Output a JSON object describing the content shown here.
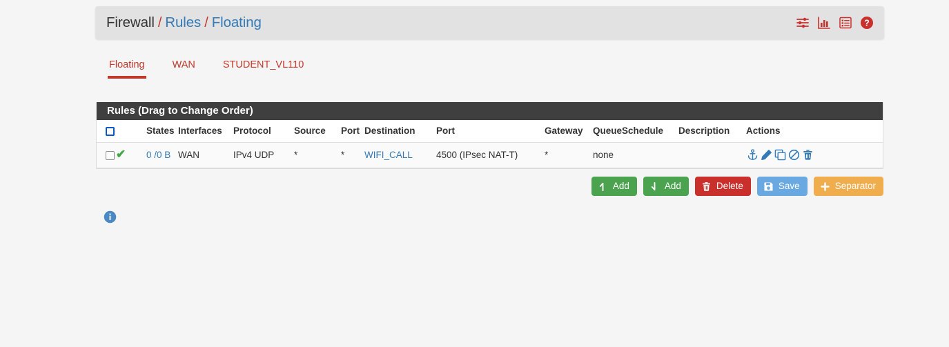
{
  "header": {
    "breadcrumb": {
      "root": "Firewall",
      "sep": "/",
      "links": [
        "Rules",
        "Floating"
      ]
    },
    "icons": [
      {
        "name": "sliders-icon",
        "label": "Advanced Filter"
      },
      {
        "name": "bar-chart-icon",
        "label": "Traffic Graphs"
      },
      {
        "name": "list-icon",
        "label": "States Summary"
      },
      {
        "name": "help-icon",
        "label": "Help"
      }
    ]
  },
  "tabs": [
    {
      "label": "Floating",
      "active": true
    },
    {
      "label": "WAN",
      "active": false
    },
    {
      "label": "STUDENT_VL110",
      "active": false
    }
  ],
  "panel": {
    "title": "Rules (Drag to Change Order)",
    "columns": [
      "",
      "",
      "States",
      "Interfaces",
      "Protocol",
      "Source",
      "Port",
      "Destination",
      "Port",
      "Gateway",
      "Queue",
      "Schedule",
      "Description",
      "Actions"
    ],
    "rows": [
      {
        "selected": false,
        "status": "pass",
        "states": "0 /0 B",
        "interfaces": "WAN",
        "protocol": "IPv4 UDP",
        "source": "*",
        "source_port": "*",
        "destination": "WIFI_CALL",
        "destination_port": "4500 (IPsec NAT-T)",
        "gateway": "*",
        "queue": "none",
        "schedule": "",
        "description": "",
        "actions": [
          "anchor-icon",
          "pencil-icon",
          "copy-icon",
          "ban-icon",
          "trash-icon"
        ]
      }
    ]
  },
  "buttons": [
    {
      "label": "Add",
      "icon": "arrow-up-icon",
      "style": "btn-green",
      "name": "add-rule-up-button"
    },
    {
      "label": "Add",
      "icon": "arrow-down-icon",
      "style": "btn-green",
      "name": "add-rule-down-button"
    },
    {
      "label": "Delete",
      "icon": "trash-icon",
      "style": "btn-red",
      "name": "delete-button"
    },
    {
      "label": "Save",
      "icon": "save-icon",
      "style": "btn-blue",
      "name": "save-button"
    },
    {
      "label": "Separator",
      "icon": "plus-icon",
      "style": "btn-orange",
      "name": "separator-button"
    }
  ],
  "footer": {
    "info_icon": "info-icon"
  },
  "colors": {
    "page_background": "#f5f5f5",
    "header_bar": "#e2e2e2",
    "accent_red": "#c0392b",
    "link_blue": "#337ab7",
    "panel_heading": "#3f3f3f",
    "pass_green": "#3fa845",
    "button_green": "#4ba34f",
    "button_red": "#c9302c",
    "button_blue": "#69a8e0",
    "button_orange": "#f0ad4e"
  }
}
